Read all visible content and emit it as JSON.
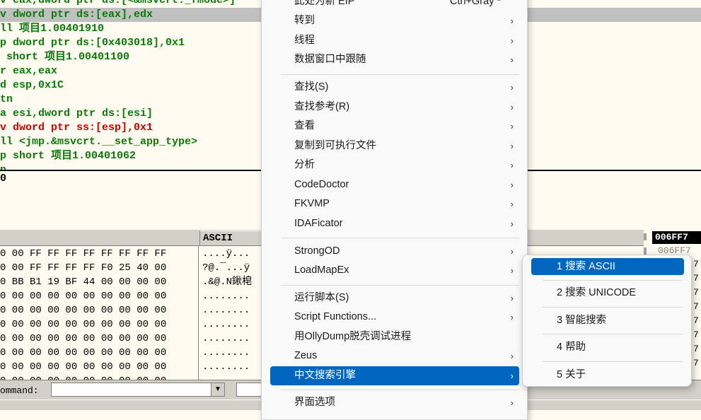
{
  "disasm": {
    "lines": [
      {
        "text": "v eax,dword ptr ds:[<&msvcrt._fmode>]"
      },
      {
        "text": "v dword ptr ds:[eax],edx",
        "selected": true
      },
      {
        "text": "ll 项目1.00401910"
      },
      {
        "text": "p dword ptr ds:[0x403018],0x1"
      },
      {
        "text": " short 项目1.00401100"
      },
      {
        "text": "r eax,eax"
      },
      {
        "text": "d esp,0x1C"
      },
      {
        "text": "tn"
      },
      {
        "text": "a esi,dword ptr ds:[esi]"
      },
      {
        "text": "v dword ptr ss:[esp],0x1"
      },
      {
        "text": "ll <jmp.&msvcrt.__set_app_type>"
      },
      {
        "text": "p short 项目1.00401062"
      },
      {
        "text": "p"
      }
    ]
  },
  "info": {
    "text": "0"
  },
  "dump": {
    "ascii_header": "ASCII",
    "rows": [
      {
        "hex": "0 00 FF FF FF FF FF FF FF FF",
        "ascii": "....ÿ..."
      },
      {
        "hex": "0 00 FF FF FF FF F0 25 40 00",
        "ascii": "?@.¯...ÿ"
      },
      {
        "hex": "0 BB B1 19 BF 44 00 00 00 00",
        "ascii": ".&@.N鍬梍"
      },
      {
        "hex": "0 00 00 00 00 00 00 00 00 00",
        "ascii": "........"
      },
      {
        "hex": "0 00 00 00 00 00 00 00 00 00",
        "ascii": "........"
      },
      {
        "hex": "0 00 00 00 00 00 00 00 00 00",
        "ascii": "........"
      },
      {
        "hex": "0 00 00 00 00 00 00 00 00 00",
        "ascii": "........"
      },
      {
        "hex": "0 00 00 00 00 00 00 00 00 00",
        "ascii": "........"
      },
      {
        "hex": "0 00 00 00 00 00 00 00 00 00",
        "ascii": "........"
      },
      {
        "hex": "0 00 00 00 00 00 00 00 00 00",
        "ascii": "........"
      }
    ]
  },
  "stack": {
    "header": "006FF7",
    "second_row": "006FF7",
    "rows": [
      "7",
      "7",
      "7",
      "7",
      "7",
      "7",
      "7",
      "7",
      "7"
    ]
  },
  "command": {
    "label": "ommand:"
  },
  "menu": {
    "items": [
      {
        "label": "此处为新 EIP",
        "shortcut": "Ctrl+Gray *",
        "arrow": false
      },
      {
        "label": "转到",
        "arrow": true
      },
      {
        "label": "线程",
        "arrow": true
      },
      {
        "label": "数据窗口中跟随",
        "arrow": true
      },
      {
        "label": "查找(S)",
        "arrow": true
      },
      {
        "label": "查找参考(R)",
        "arrow": true
      },
      {
        "label": "查看",
        "arrow": true
      },
      {
        "label": "复制到可执行文件",
        "arrow": true
      },
      {
        "label": "分析",
        "arrow": true
      },
      {
        "label": "CodeDoctor",
        "arrow": true
      },
      {
        "label": "FKVMP",
        "arrow": true
      },
      {
        "label": "IDAFicator",
        "arrow": true
      },
      {
        "label": "StrongOD",
        "arrow": true
      },
      {
        "label": "LoadMapEx",
        "arrow": true
      },
      {
        "label": "运行脚本(S)",
        "arrow": true
      },
      {
        "label": "Script Functions...",
        "arrow": true
      },
      {
        "label": "用OllyDump脱壳调试进程",
        "arrow": false
      },
      {
        "label": "Zeus",
        "arrow": true
      },
      {
        "label": "中文搜索引擎",
        "arrow": true,
        "active": true
      },
      {
        "label": "界面选项",
        "arrow": true
      }
    ],
    "arrow_glyph": "›"
  },
  "submenu": {
    "items": [
      {
        "label": "1 搜索 ASCII",
        "active": true
      },
      {
        "label": "2 搜索 UNICODE"
      },
      {
        "label": "3 智能搜索"
      },
      {
        "label": "4 帮助"
      },
      {
        "label": "5 关于"
      }
    ]
  },
  "colors": {
    "pane_bg": "#fffbf0",
    "asm_green": "#0a7a0a",
    "asm_red": "#d00000",
    "menu_highlight": "#0067c0"
  }
}
